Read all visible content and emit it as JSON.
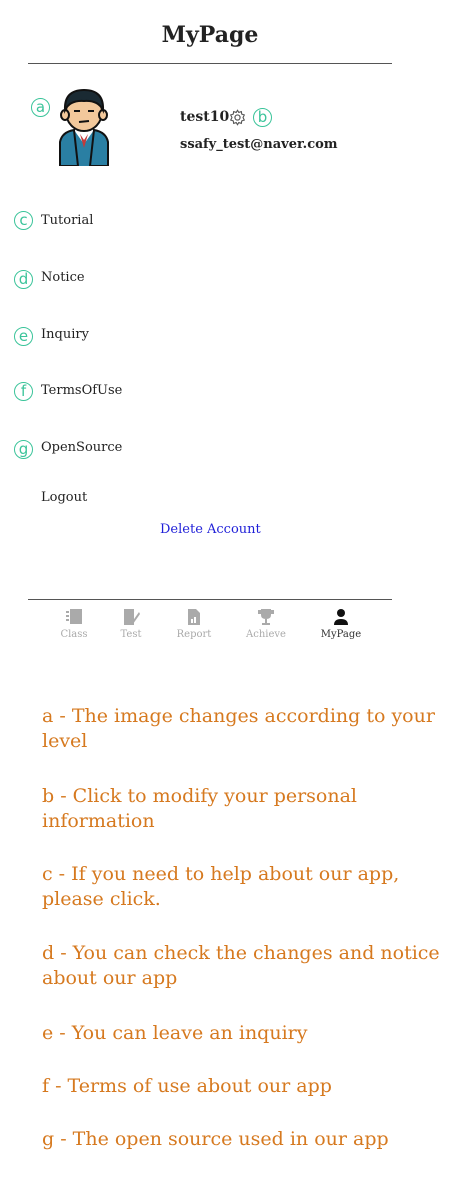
{
  "header": {
    "title": "MyPage"
  },
  "markers": [
    "a",
    "b",
    "c",
    "d",
    "e",
    "f",
    "g"
  ],
  "profile": {
    "username": "test10",
    "email": "ssafy_test@naver.com"
  },
  "menu": [
    {
      "label": "Tutorial"
    },
    {
      "label": "Notice"
    },
    {
      "label": "Inquiry"
    },
    {
      "label": "TermsOfUse"
    },
    {
      "label": "OpenSource"
    }
  ],
  "logout_label": "Logout",
  "delete_label": "Delete Account",
  "nav": [
    {
      "label": "Class",
      "icon": "class-icon"
    },
    {
      "label": "Test",
      "icon": "test-icon"
    },
    {
      "label": "Report",
      "icon": "report-icon"
    },
    {
      "label": "Achieve",
      "icon": "trophy-icon"
    },
    {
      "label": "MyPage",
      "icon": "person-icon",
      "active": true
    }
  ],
  "notes": [
    "a - The image changes according to your level",
    "b - Click to modify your personal information",
    "c - If you need to help about our app, please click.",
    "d - You can check the changes and notice about our app",
    "e - You can leave an inquiry",
    "f - Terms of use about our app",
    "g - The open source used in our app"
  ],
  "colors": {
    "annotation": "#d6791f",
    "marker": "#3bc49a",
    "link": "#1f1fd8"
  }
}
